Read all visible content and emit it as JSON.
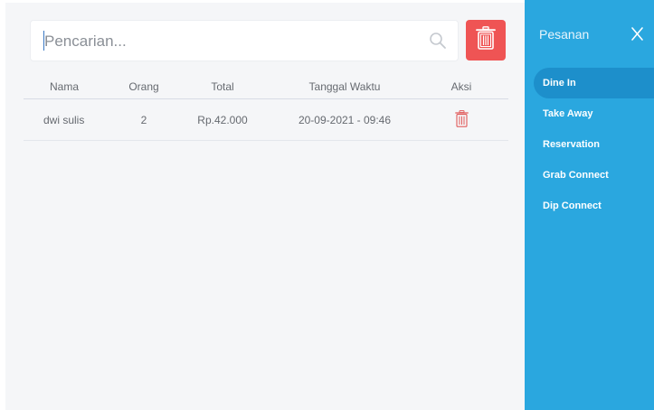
{
  "search": {
    "placeholder": "Pencarian..."
  },
  "table": {
    "headers": {
      "nama": "Nama",
      "orang": "Orang",
      "total": "Total",
      "waktu": "Tanggal Waktu",
      "aksi": "Aksi"
    },
    "rows": [
      {
        "nama": "dwi sulis",
        "orang": "2",
        "total": "Rp.42.000",
        "waktu": "20-09-2021 - 09:46"
      }
    ]
  },
  "sidebar": {
    "title": "Pesanan",
    "close_label": "X",
    "items": [
      {
        "label": "Dine In",
        "active": true
      },
      {
        "label": "Take Away",
        "active": false
      },
      {
        "label": "Reservation",
        "active": false
      },
      {
        "label": "Grab Connect",
        "active": false
      },
      {
        "label": "Dip Connect",
        "active": false
      }
    ]
  },
  "colors": {
    "sidebar_bg": "#2aa7df",
    "sidebar_active": "#1d8fcb",
    "delete_button": "#ef5454",
    "row_trash_icon": "#e05a5a"
  },
  "icons": {
    "search": "search-icon",
    "delete_all": "trash-icon",
    "row_delete": "trash-icon",
    "close": "close-icon"
  }
}
